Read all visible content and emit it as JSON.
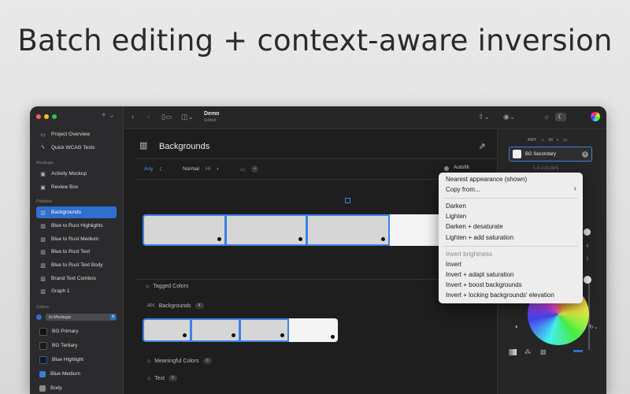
{
  "headline": "Batch editing + context-aware inversion",
  "toolbar": {
    "doc_title": "Demo",
    "doc_subtitle": "Edited"
  },
  "sidebar": {
    "top_items": [
      {
        "label": "Project Overview",
        "icon": "folder-icon"
      },
      {
        "label": "Quick WCAG Tests",
        "icon": "bolt-icon"
      }
    ],
    "mockups_header": "Mockups",
    "mockup_items": [
      {
        "label": "Activity Mockup"
      },
      {
        "label": "Review Box"
      }
    ],
    "palettes_header": "Palettes",
    "palette_items": [
      {
        "label": "Backgrounds",
        "selected": true
      },
      {
        "label": "Blue to Rust Highlights"
      },
      {
        "label": "Blue to Rust Medium"
      },
      {
        "label": "Blue to Rust Text"
      },
      {
        "label": "Blue to Rust Text Body"
      },
      {
        "label": "Brand Text Combos"
      },
      {
        "label": "Graph 1"
      }
    ],
    "colors_header": "Colors",
    "mockup_filter": "In Mockups",
    "color_items": [
      {
        "label": "BG Primary",
        "color": "#111111"
      },
      {
        "label": "BG Tertiary",
        "color": "#1c1c1c"
      },
      {
        "label": "Blue Highlight",
        "color": "#0d1c33"
      },
      {
        "label": "Blue Medium",
        "color": "#3b7ed8"
      },
      {
        "label": "Body",
        "color": "#8a8a8a"
      }
    ]
  },
  "main": {
    "palette_title": "Backgrounds",
    "appearance": {
      "any": "Any",
      "normal": "Normal",
      "hi": "Hi",
      "autofill": "Autofill"
    },
    "tagged_colors": "Tagged Colors",
    "backgrounds_tag": {
      "prefix": "abc",
      "label": "Backgrounds",
      "count": "4"
    },
    "meaningful_colors": {
      "label": "Meaningful Colors",
      "count": "0"
    },
    "text_tag": {
      "label": "Text",
      "count": "0"
    }
  },
  "right_panel": {
    "appearance_any": "ANY",
    "appearance_hi": "HI",
    "selected_color": "BG Secondary",
    "hidden_label": "1.4 COLORS"
  },
  "context_menu": {
    "items": [
      {
        "label": "Nearest appearance (shown)",
        "enabled": true
      },
      {
        "label": "Copy from...",
        "enabled": true,
        "submenu": true
      },
      {
        "label": "Darken",
        "enabled": true
      },
      {
        "label": "Lighten",
        "enabled": true
      },
      {
        "label": "Darken + desaturate",
        "enabled": true
      },
      {
        "label": "Lighten + add saturation",
        "enabled": true
      },
      {
        "label": "Invert brightness",
        "enabled": false
      },
      {
        "label": "Invert",
        "enabled": true
      },
      {
        "label": "Invert + adapt saturation",
        "enabled": true
      },
      {
        "label": "Invert + boost backgrounds",
        "enabled": true
      },
      {
        "label": "Invert + locking backgrounds' elevation",
        "enabled": true
      }
    ]
  }
}
